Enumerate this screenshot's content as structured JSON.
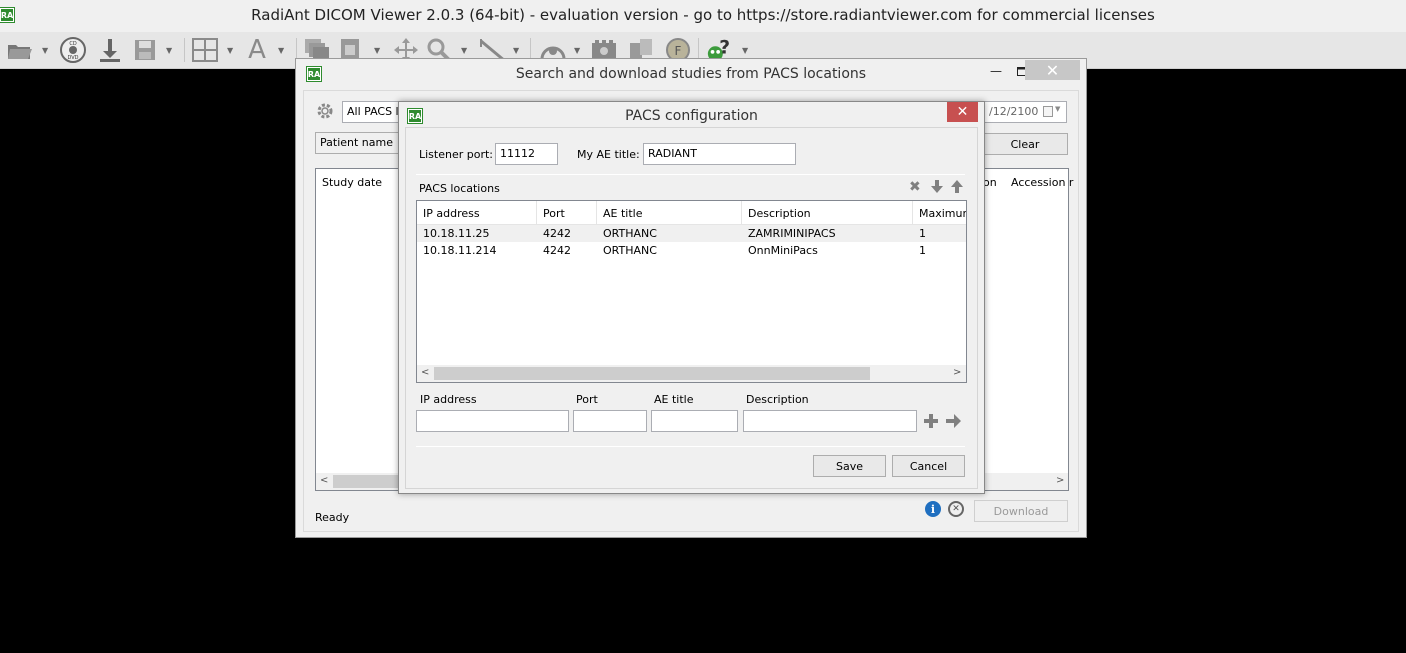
{
  "app": {
    "title": "RadiAnt DICOM Viewer 2.0.3 (64-bit) - evaluation version - go to https://store.radiantviewer.com for commercial licenses",
    "logo": "RA"
  },
  "toolbar": {
    "icons": [
      "open-folder-icon",
      "cd-dvd-icon",
      "download-icon",
      "save-icon",
      "layout-grid-icon",
      "text-annotation-icon",
      "series-stack-icon",
      "window-level-icon",
      "pan-icon",
      "zoom-icon",
      "measure-icon",
      "cine-icon",
      "video-icon",
      "fusion-icon",
      "filter-icon",
      "help-icon"
    ]
  },
  "search_window": {
    "title": "Search and download studies from PACS locations",
    "logo": "RA",
    "location_select": "All PACS loc",
    "date_to": "/12/2100",
    "patient_name_label": "Patient name",
    "clear_button": "Clear",
    "columns": {
      "study_date": "Study date",
      "on": "on",
      "accession": "Accession r"
    },
    "status": "Ready",
    "download_button": "Download"
  },
  "pacs_dialog": {
    "title": "PACS configuration",
    "logo": "RA",
    "close_glyph": "✕",
    "listener_port_label": "Listener port:",
    "listener_port_value": "11112",
    "ae_title_label": "My AE title:",
    "ae_title_value": "RADIANT",
    "locations_label": "PACS locations",
    "table": {
      "headers": [
        "IP address",
        "Port",
        "AE title",
        "Description",
        "Maximum"
      ],
      "rows": [
        [
          "10.18.11.25",
          "4242",
          "ORTHANC",
          "ZAMRIMINIPACS",
          "1"
        ],
        [
          "10.18.11.214",
          "4242",
          "ORTHANC",
          "OnnMiniPacs",
          "1"
        ]
      ]
    },
    "new_entry": {
      "ip_label": "IP address",
      "port_label": "Port",
      "ae_label": "AE title",
      "desc_label": "Description"
    },
    "save_button": "Save",
    "cancel_button": "Cancel"
  }
}
